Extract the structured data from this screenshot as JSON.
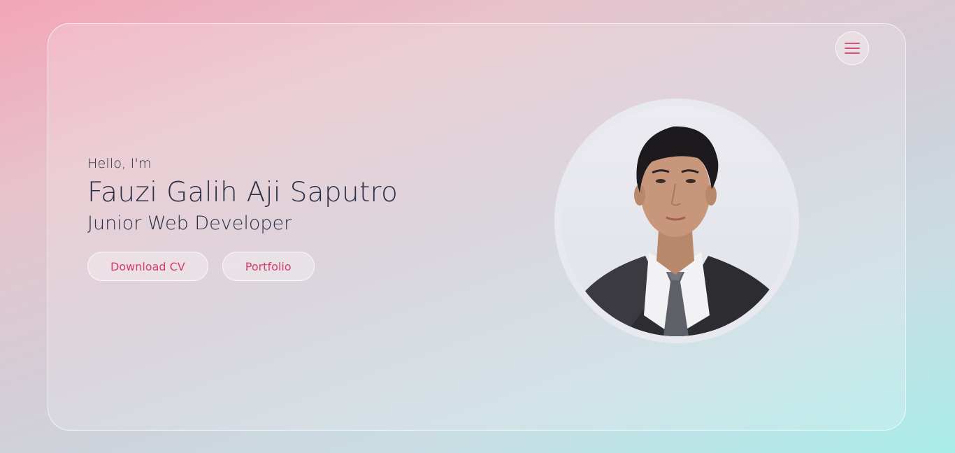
{
  "hero": {
    "greeting": "Hello, I'm",
    "name": "Fauzi Galih Aji Saputro",
    "role": "Junior Web Developer"
  },
  "buttons": {
    "download_cv": "Download CV",
    "portfolio": "Portfolio"
  },
  "menu": {
    "icon": "hamburger-menu-icon"
  },
  "profile_photo": {
    "description": "portrait"
  },
  "colors": {
    "accent": "#d63d6c",
    "text": "#2a2f45"
  }
}
